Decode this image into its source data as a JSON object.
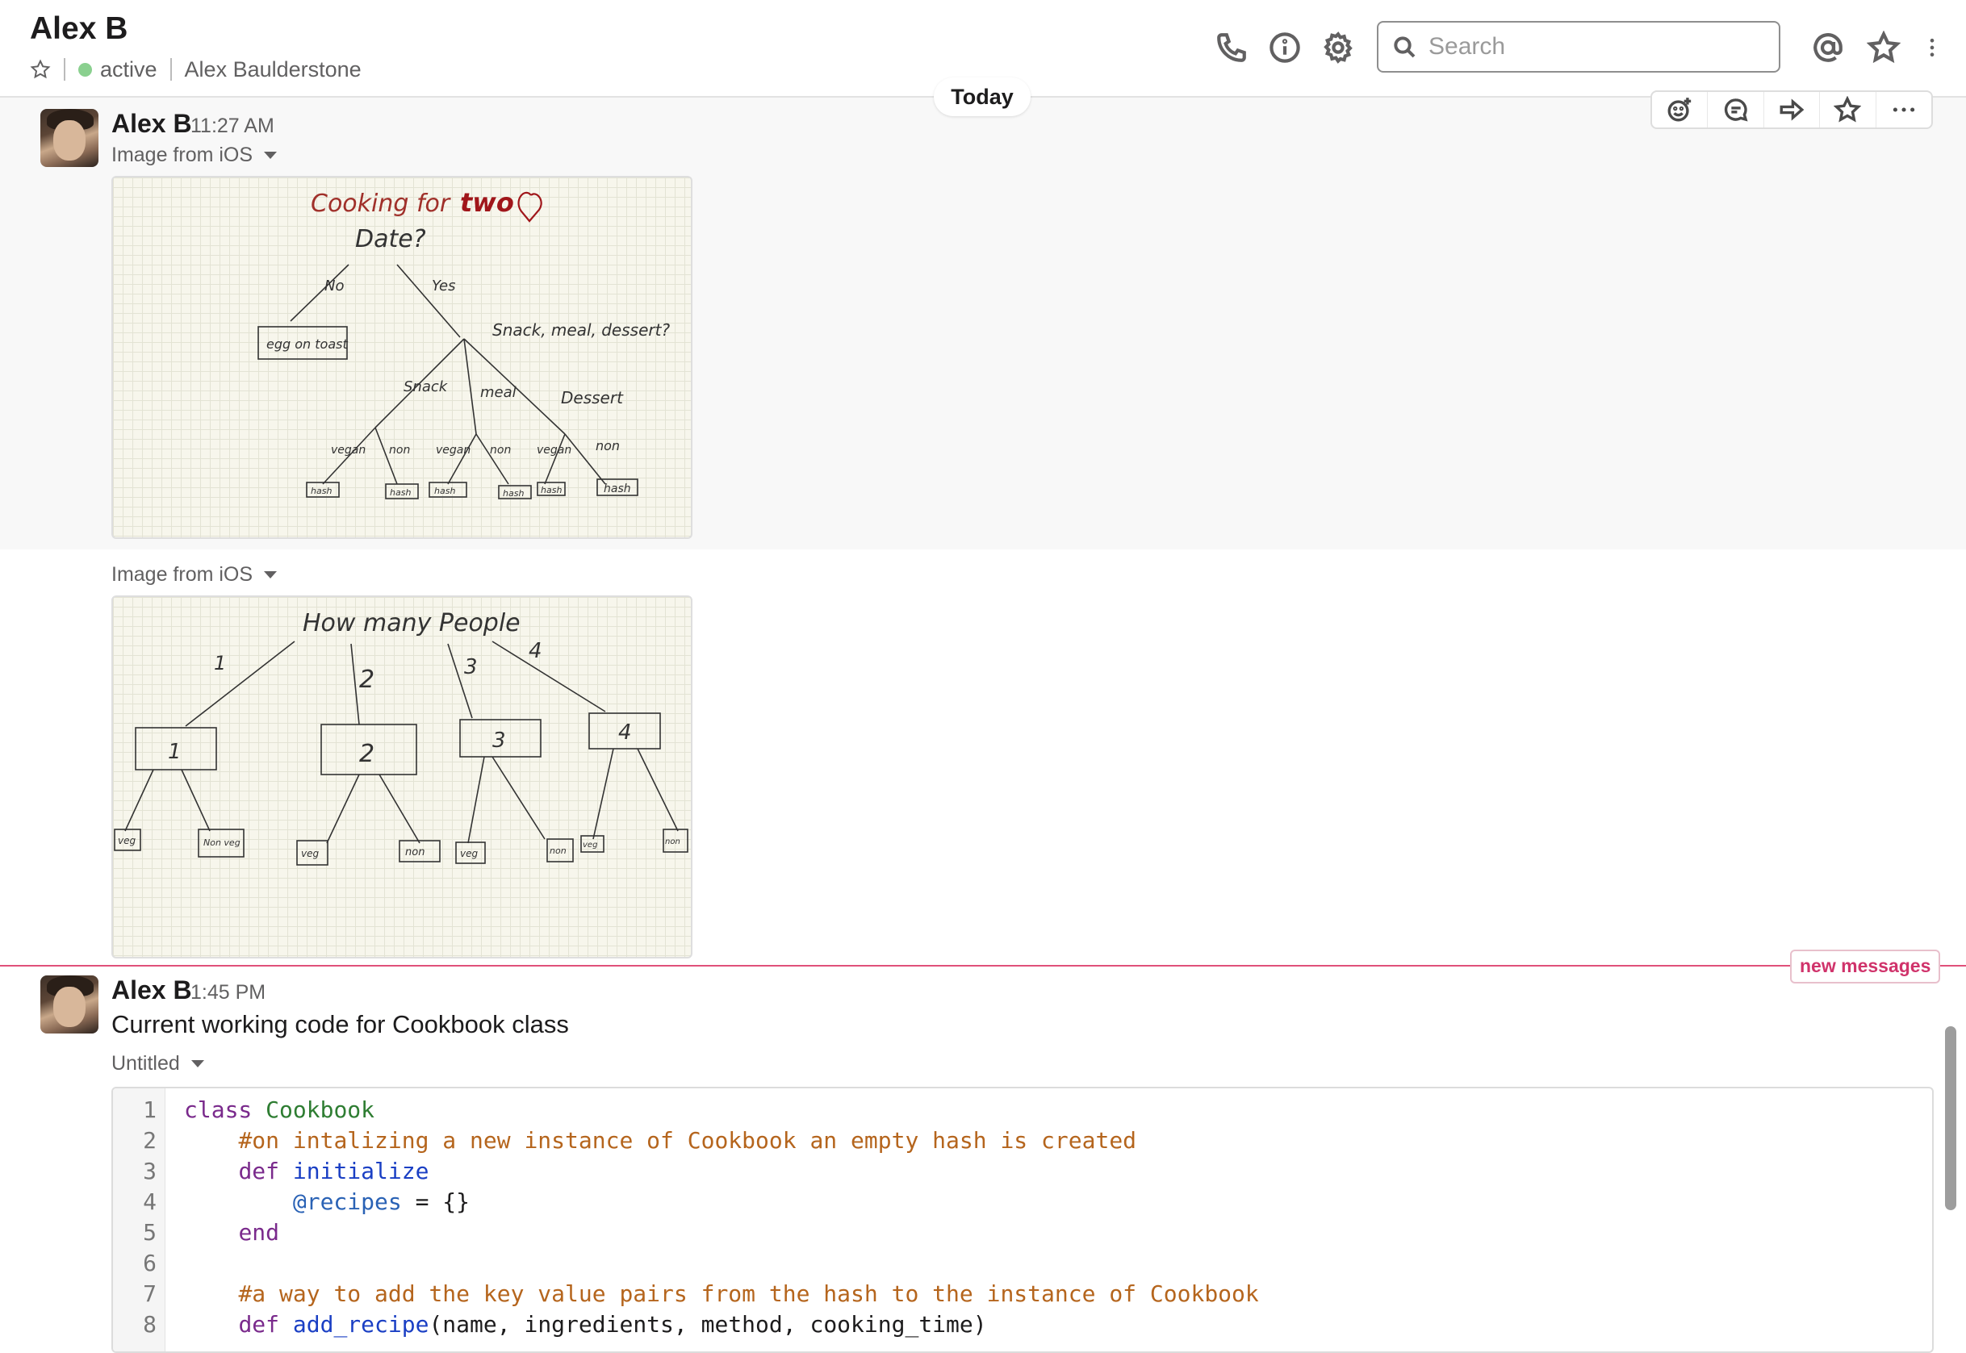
{
  "header": {
    "title": "Alex B",
    "status": "active",
    "full_name": "Alex Baulderstone",
    "search_placeholder": "Search",
    "icons": [
      "star-icon",
      "phone-icon",
      "info-icon",
      "gear-icon",
      "search-icon",
      "at-icon",
      "star-icon",
      "more-vertical-icon"
    ]
  },
  "day_divider": "Today",
  "message_actions": [
    "add-reaction-icon",
    "reply-thread-icon",
    "share-icon",
    "star-icon",
    "more-horizontal-icon"
  ],
  "messages": [
    {
      "sender": "Alex B",
      "time": "11:27 AM",
      "files": [
        {
          "label": "Image from iOS",
          "sketch": {
            "title_a": "Cooking for",
            "title_b": "two",
            "q1": "Date?",
            "no": "No",
            "yes": "Yes",
            "leaf": "egg on toast",
            "q2": "Snack, meal, dessert?",
            "snack": "Snack",
            "meal": "meal",
            "dessert": "Dessert",
            "vegan": "vegan",
            "non": "non",
            "hash": "hash"
          }
        },
        {
          "label": "Image from iOS",
          "sketch": {
            "title": "How many People",
            "n1": "1",
            "n2": "2",
            "n3": "3",
            "n4": "4",
            "veg": "veg",
            "non_veg": "Non veg",
            "non": "non"
          }
        }
      ]
    },
    {
      "sender": "Alex B",
      "time": "1:45 PM",
      "text": "Current working code for Cookbook class",
      "snippet_label": "Untitled",
      "code_lines": [
        {
          "n": "1",
          "parts": [
            [
              "kw",
              "class "
            ],
            [
              "cls",
              "Cookbook"
            ]
          ]
        },
        {
          "n": "2",
          "parts": [
            [
              "pl",
              "    "
            ],
            [
              "cm",
              "#on intalizing a new instance of Cookbook an empty hash is created"
            ]
          ]
        },
        {
          "n": "3",
          "parts": [
            [
              "pl",
              "    "
            ],
            [
              "kw",
              "def "
            ],
            [
              "fn",
              "initialize"
            ]
          ]
        },
        {
          "n": "4",
          "parts": [
            [
              "pl",
              "        "
            ],
            [
              "iv",
              "@recipes"
            ],
            [
              "pl",
              " = {}"
            ]
          ]
        },
        {
          "n": "5",
          "parts": [
            [
              "pl",
              "    "
            ],
            [
              "kw",
              "end"
            ]
          ]
        },
        {
          "n": "6",
          "parts": [
            [
              "pl",
              ""
            ]
          ]
        },
        {
          "n": "7",
          "parts": [
            [
              "pl",
              "    "
            ],
            [
              "cm",
              "#a way to add the key value pairs from the hash to the instance of Cookbook"
            ]
          ]
        },
        {
          "n": "8",
          "parts": [
            [
              "pl",
              "    "
            ],
            [
              "kw",
              "def "
            ],
            [
              "fn",
              "add_recipe"
            ],
            [
              "pl",
              "(name, ingredients, method, cooking_time)"
            ]
          ]
        }
      ]
    }
  ],
  "new_messages_label": "new messages",
  "colors": {
    "presence": "#8ad08f",
    "new_messages": "#e0507a",
    "keyword": "#7a2a8c",
    "class_name": "#2e7d32",
    "comment": "#b5651d",
    "method": "#1a3fc4",
    "ivar": "#2a62b5"
  }
}
